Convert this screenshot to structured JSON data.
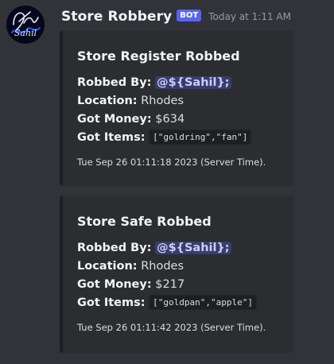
{
  "message": {
    "avatar_icon": "avatar-logo",
    "username": "Store Robbery",
    "bot_tag": "BOT",
    "timestamp": "Today at 1:11 AM"
  },
  "embeds": [
    {
      "title": "Store Register Robbed",
      "fields": [
        {
          "label": "Robbed By:",
          "value": "@${Sahil};",
          "style": "mention"
        },
        {
          "label": "Location:",
          "value": "Rhodes",
          "style": "text"
        },
        {
          "label": "Got Money:",
          "value": "$634",
          "style": "text"
        },
        {
          "label": "Got Items:",
          "value": "[\"goldring\",\"fan\"]",
          "style": "code"
        }
      ],
      "footer": "Tue Sep 26 01:11:18 2023 (Server Time)."
    },
    {
      "title": "Store Safe Robbed",
      "fields": [
        {
          "label": "Robbed By:",
          "value": "@${Sahil};",
          "style": "mention"
        },
        {
          "label": "Location:",
          "value": "Rhodes",
          "style": "text"
        },
        {
          "label": "Got Money:",
          "value": "$217",
          "style": "text"
        },
        {
          "label": "Got Items:",
          "value": "[\"goldpan\",\"apple\"]",
          "style": "code"
        }
      ],
      "footer": "Tue Sep 26 01:11:42 2023 (Server Time)."
    }
  ],
  "colors": {
    "background": "#313338",
    "embed_background": "#2b2d31",
    "bot_tag": "#5865f2",
    "mention": "#c9cdfb"
  }
}
